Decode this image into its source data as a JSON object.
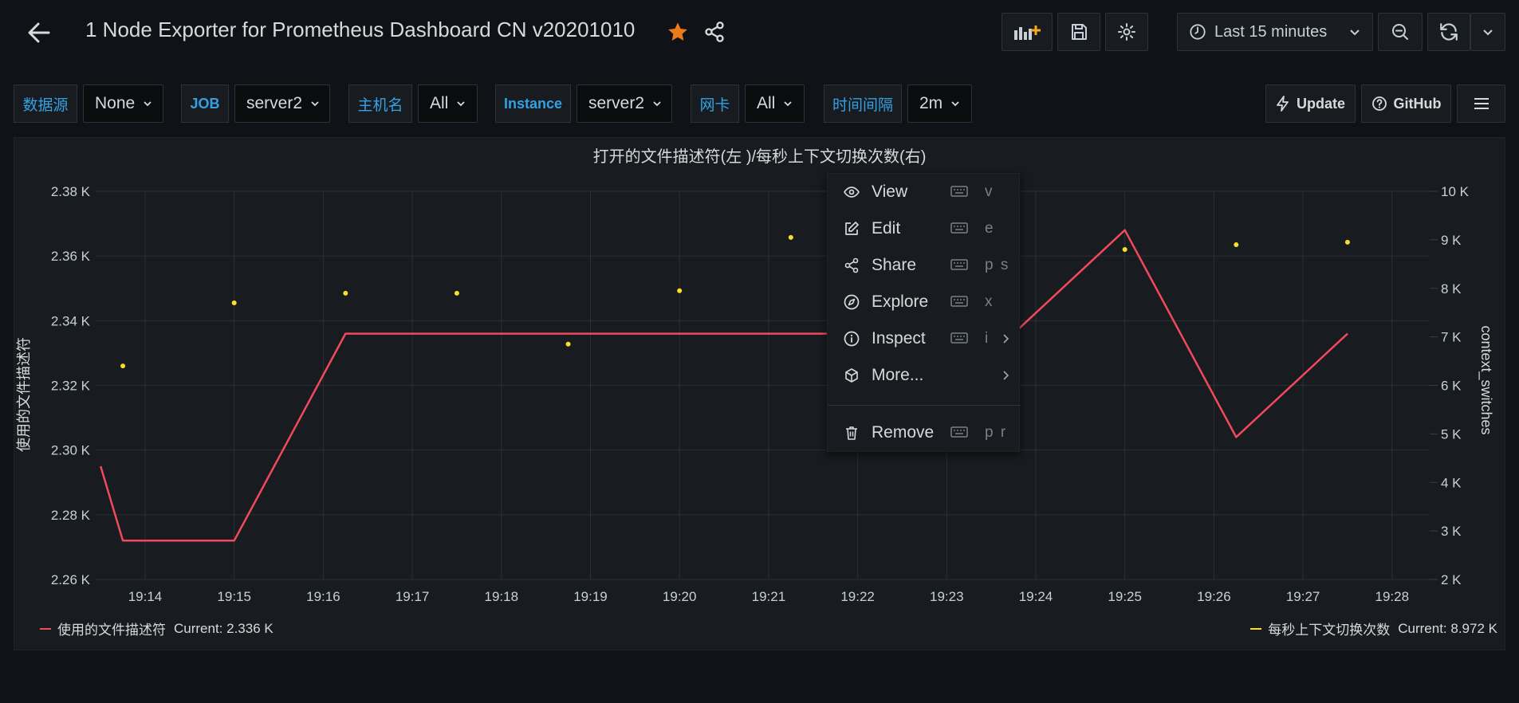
{
  "dashboard": {
    "title": "1 Node Exporter for Prometheus Dashboard CN v20201010"
  },
  "toolbar": {
    "time_range": "Last 15 minutes"
  },
  "variables": [
    {
      "label": "数据源",
      "value": "None"
    },
    {
      "label": "JOB",
      "value": "server2"
    },
    {
      "label": "主机名",
      "value": "All"
    },
    {
      "label": "Instance",
      "value": "server2"
    },
    {
      "label": "网卡",
      "value": "All"
    },
    {
      "label": "时间间隔",
      "value": "2m"
    }
  ],
  "links": {
    "update": "Update",
    "github": "GitHub"
  },
  "panel": {
    "title": "打开的文件描述符(左 )/每秒上下文切换次数(右)"
  },
  "chart_data": {
    "type": "line",
    "title": "打开的文件描述符(左 )/每秒上下文切换次数(右)",
    "ylabel_left": "使用的文件描述符",
    "ylabel_right": "context_switches",
    "x_ticks": [
      "19:14",
      "19:15",
      "19:16",
      "19:17",
      "19:18",
      "19:19",
      "19:20",
      "19:21",
      "19:22",
      "19:23",
      "19:24",
      "19:25",
      "19:26",
      "19:27",
      "19:28"
    ],
    "y_left_ticks": [
      "2.38 K",
      "2.36 K",
      "2.34 K",
      "2.32 K",
      "2.30 K",
      "2.28 K",
      "2.26 K"
    ],
    "y_right_ticks": [
      "10 K",
      "9 K",
      "8 K",
      "7 K",
      "6 K",
      "5 K",
      "4 K",
      "3 K",
      "2 K"
    ],
    "ylim_left": [
      2260,
      2380
    ],
    "ylim_right": [
      2000,
      10000
    ],
    "grid": true,
    "series": [
      {
        "name": "使用的文件描述符",
        "axis": "left",
        "style": "line",
        "color": "#f2495c",
        "x": [
          "19:13:30",
          "19:13:45",
          "19:15:00",
          "19:16:15",
          "19:22:00",
          "19:23:45",
          "19:25:00",
          "19:26:15",
          "19:27:30"
        ],
        "values": [
          2295,
          2272,
          2272,
          2336,
          2336,
          2336,
          2368,
          2304,
          2336
        ],
        "current": "Current: 2.336 K"
      },
      {
        "name": "每秒上下文切换次数",
        "axis": "right",
        "style": "points",
        "color": "#fade2a",
        "x": [
          "19:13:45",
          "19:15:00",
          "19:16:15",
          "19:17:30",
          "19:18:45",
          "19:20:00",
          "19:21:15",
          "19:25:00",
          "19:26:15",
          "19:27:30"
        ],
        "values": [
          6400,
          7700,
          7900,
          7900,
          6850,
          7950,
          9050,
          8800,
          8900,
          8950
        ],
        "current": "Current: 8.972 K"
      }
    ]
  },
  "context_menu": {
    "items": [
      {
        "label": "View",
        "shortcut": "v"
      },
      {
        "label": "Edit",
        "shortcut": "e"
      },
      {
        "label": "Share",
        "shortcut": "p s"
      },
      {
        "label": "Explore",
        "shortcut": "x"
      },
      {
        "label": "Inspect",
        "shortcut": "i"
      },
      {
        "label": "More..."
      },
      {
        "label": "Remove",
        "shortcut": "p r"
      }
    ]
  }
}
